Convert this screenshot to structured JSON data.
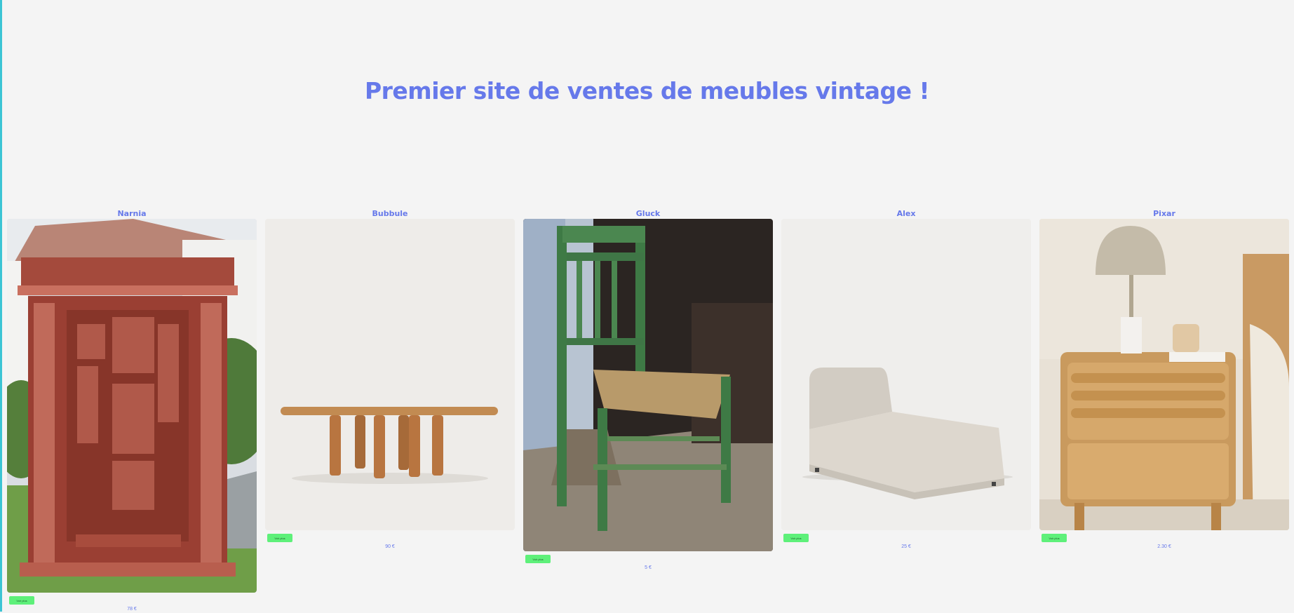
{
  "page": {
    "title": "Premier site de ventes de meubles vintage !"
  },
  "products": [
    {
      "name": "Narnia",
      "button_label": "Voir plus",
      "price": "78 €",
      "image": "carved red wooden wardrobe in garden"
    },
    {
      "name": "Bubbule",
      "button_label": "Voir plus",
      "price": "90 €",
      "image": "oval wooden table with cylindrical legs"
    },
    {
      "name": "Gluck",
      "button_label": "Voir plus",
      "price": "5 €",
      "image": "old green wooden chair with broken straw seat"
    },
    {
      "name": "Alex",
      "button_label": "Voir plus",
      "price": "25 €",
      "image": "beige upholstered chaise longue"
    },
    {
      "name": "Pixar",
      "button_label": "Voir plus",
      "price": "2.30 €",
      "image": "wooden bedside table with lamp"
    }
  ],
  "colors": {
    "accent": "#6679ea",
    "button": "#5ef07a",
    "background": "#f4f4f4"
  }
}
